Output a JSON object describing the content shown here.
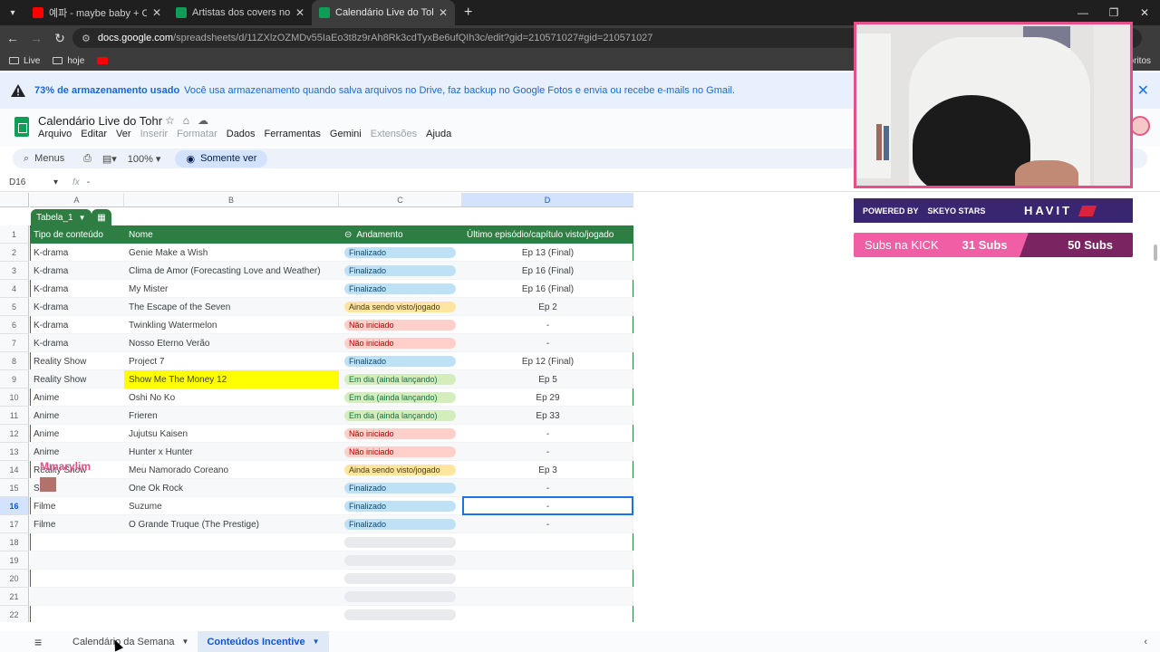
{
  "browser": {
    "tabs": [
      {
        "title": "예파 - maybe baby + CAN I SIP",
        "favicon_color": "#ff0000",
        "active": false
      },
      {
        "title": "Artistas dos covers no Mujin - C",
        "favicon_color": "#0f9d58",
        "active": false
      },
      {
        "title": "Calendário Live do Tohr - Goog",
        "favicon_color": "#0f9d58",
        "active": true
      }
    ],
    "new_tab": "+",
    "url_host": "docs.google.com",
    "url_path": "/spreadsheets/d/11ZXlzOZMDv55IaEo3t8z9rAh8Rk3cdTyxBe6ufQIh3c/edit?gid=210571027#gid=210571027",
    "bookmarks": [
      "Live",
      "hoje"
    ],
    "bookmarks_right": "oritos"
  },
  "banner": {
    "bold": "73% de armazenamento usado",
    "message": "Você usa armazenamento quando salva arquivos no Drive, faz backup no Google Fotos e envia ou recebe e-mails no Gmail."
  },
  "doc": {
    "title": "Calendário Live do Tohr",
    "menus": [
      {
        "label": "Arquivo",
        "disabled": false
      },
      {
        "label": "Editar",
        "disabled": false
      },
      {
        "label": "Ver",
        "disabled": false
      },
      {
        "label": "Inserir",
        "disabled": true
      },
      {
        "label": "Formatar",
        "disabled": true
      },
      {
        "label": "Dados",
        "disabled": false
      },
      {
        "label": "Ferramentas",
        "disabled": false
      },
      {
        "label": "Gemini",
        "disabled": false
      },
      {
        "label": "Extensões",
        "disabled": true
      },
      {
        "label": "Ajuda",
        "disabled": false
      }
    ]
  },
  "toolbar": {
    "search_label": "Menus",
    "zoom": "100%",
    "view_mode": "Somente ver"
  },
  "formula": {
    "cell_ref": "D16",
    "content": "-"
  },
  "grid": {
    "columns": [
      "A",
      "B",
      "C",
      "D"
    ],
    "selected_column": "D",
    "selected_row": 16,
    "table_name": "Tabela_1",
    "headers": [
      "Tipo de conteúdo",
      "Nome",
      "Andamento",
      "Último episódio/capítulo visto/jogado"
    ],
    "status_colors": {
      "Finalizado": {
        "bg": "#bfe1f6",
        "fg": "#0b4a75"
      },
      "Ainda sendo visto/jogado": {
        "bg": "#ffe5a0",
        "fg": "#473821"
      },
      "Não iniciado": {
        "bg": "#ffcfc9",
        "fg": "#b10202"
      },
      "Em dia (ainda lançando)": {
        "bg": "#d4edbc",
        "fg": "#11734b"
      }
    },
    "rows": [
      {
        "n": 2,
        "tipo": "K-drama",
        "nome": "Genie Make a Wish",
        "status": "Finalizado",
        "ep": "Ep 13 (Final)"
      },
      {
        "n": 3,
        "tipo": "K-drama",
        "nome": "Clima de Amor (Forecasting Love and Weather)",
        "status": "Finalizado",
        "ep": "Ep 16 (Final)"
      },
      {
        "n": 4,
        "tipo": "K-drama",
        "nome": "My Mister",
        "status": "Finalizado",
        "ep": "Ep 16 (Final)"
      },
      {
        "n": 5,
        "tipo": "K-drama",
        "nome": "The Escape of the Seven",
        "status": "Ainda sendo visto/jogado",
        "ep": "Ep 2"
      },
      {
        "n": 6,
        "tipo": "K-drama",
        "nome": "Twinkling Watermelon",
        "status": "Não iniciado",
        "ep": "-"
      },
      {
        "n": 7,
        "tipo": "K-drama",
        "nome": "Nosso Eterno Verão",
        "status": "Não iniciado",
        "ep": "-"
      },
      {
        "n": 8,
        "tipo": "Reality Show",
        "nome": "Project 7",
        "status": "Finalizado",
        "ep": "Ep 12 (Final)"
      },
      {
        "n": 9,
        "tipo": "Reality Show",
        "nome": "Show Me The Money 12",
        "status": "Em dia (ainda lançando)",
        "ep": "Ep 5",
        "highlight": true
      },
      {
        "n": 10,
        "tipo": "Anime",
        "nome": "Oshi No Ko",
        "status": "Em dia (ainda lançando)",
        "ep": "Ep 29"
      },
      {
        "n": 11,
        "tipo": "Anime",
        "nome": "Frieren",
        "status": "Em dia (ainda lançando)",
        "ep": "Ep 33"
      },
      {
        "n": 12,
        "tipo": "Anime",
        "nome": "Jujutsu Kaisen",
        "status": "Não iniciado",
        "ep": "-"
      },
      {
        "n": 13,
        "tipo": "Anime",
        "nome": "Hunter x Hunter",
        "status": "Não iniciado",
        "ep": "-"
      },
      {
        "n": 14,
        "tipo": "Reality Show",
        "nome": "Meu Namorado Coreano",
        "status": "Ainda sendo visto/jogado",
        "ep": "Ep 3"
      },
      {
        "n": 15,
        "tipo": "Show",
        "nome": "One Ok Rock",
        "status": "Finalizado",
        "ep": "-"
      },
      {
        "n": 16,
        "tipo": "Filme",
        "nome": "Suzume",
        "status": "Finalizado",
        "ep": "-"
      },
      {
        "n": 17,
        "tipo": "Filme",
        "nome": "O Grande Truque (The Prestige)",
        "status": "Finalizado",
        "ep": "-"
      }
    ],
    "empty_rows": [
      18,
      19,
      20,
      21,
      22
    ]
  },
  "sheets": {
    "tabs": [
      {
        "label": "Calendário da Semana",
        "active": false
      },
      {
        "label": "Conteúdos Incentive",
        "active": true
      }
    ]
  },
  "overlays": {
    "powered_by": "POWERED BY",
    "sponsor_1": "SKEYO STARS",
    "sponsor_2": "HAVIT",
    "subs_label": "Subs na KICK",
    "subs_current": "31 Subs",
    "subs_goal": "50 Subs",
    "watermark": "Mmarylim"
  }
}
